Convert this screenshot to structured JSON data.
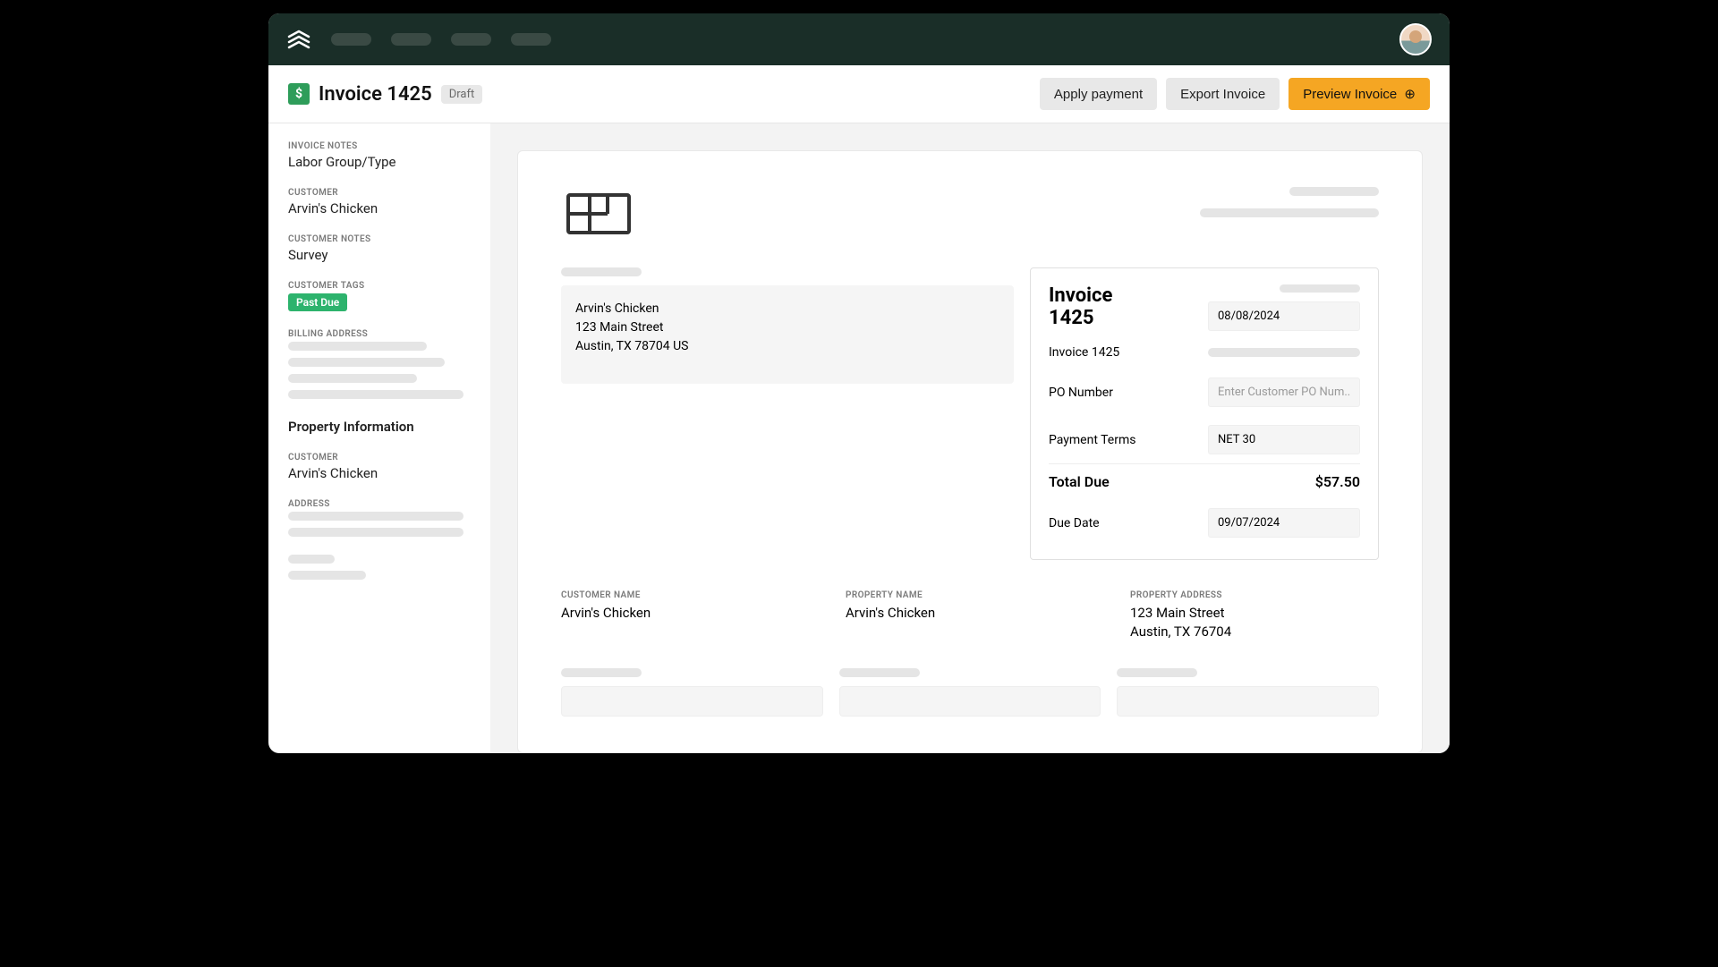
{
  "header": {
    "title": "Invoice 1425",
    "status_badge": "Draft",
    "icon_char": "$",
    "actions": {
      "apply_payment": "Apply payment",
      "export_invoice": "Export Invoice",
      "preview_invoice": "Preview Invoice"
    }
  },
  "sidebar": {
    "invoice_notes": {
      "label": "INVOICE NOTES",
      "value": "Labor Group/Type"
    },
    "customer": {
      "label": "CUSTOMER",
      "value": "Arvin's Chicken"
    },
    "customer_notes": {
      "label": "CUSTOMER NOTES",
      "value": "Survey"
    },
    "customer_tags": {
      "label": "CUSTOMER TAGS",
      "tag": "Past Due"
    },
    "billing_address": {
      "label": "BILLING ADDRESS"
    },
    "property_section": "Property Information",
    "prop_customer": {
      "label": "CUSTOMER",
      "value": "Arvin's Chicken"
    },
    "address": {
      "label": "ADDRESS"
    }
  },
  "invoice": {
    "bill_to": {
      "name": "Arvin's Chicken",
      "street": "123 Main Street",
      "city_line": "Austin, TX 78704 US"
    },
    "card": {
      "title": "Invoice 1425",
      "date": "08/08/2024",
      "number_label": "Invoice 1425",
      "po_label": "PO Number",
      "po_placeholder": "Enter Customer PO Num...",
      "terms_label": "Payment Terms",
      "terms_value": "NET 30",
      "total_due_label": "Total Due",
      "total_due_value": "$57.50",
      "due_date_label": "Due Date",
      "due_date_value": "09/07/2024"
    },
    "details": {
      "customer_name": {
        "label": "CUSTOMER NAME",
        "value": "Arvin's Chicken"
      },
      "property_name": {
        "label": "PROPERTY NAME",
        "value": "Arvin's Chicken"
      },
      "property_address": {
        "label": "PROPERTY ADDRESS",
        "line1": "123 Main Street",
        "line2": "Austin, TX 76704"
      }
    }
  },
  "icons": {
    "preview_circ": "⊕"
  }
}
